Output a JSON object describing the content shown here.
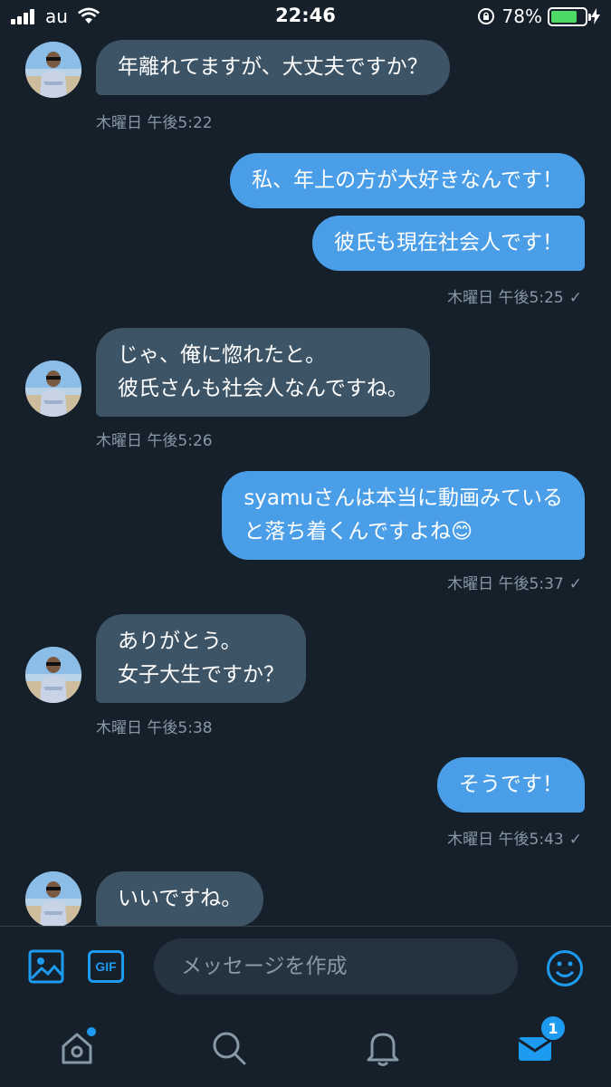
{
  "status_bar": {
    "carrier": "au",
    "time": "22:46",
    "battery_percent": "78%",
    "battery_level": 0.78,
    "signal_bars": 4
  },
  "messages": [
    {
      "direction": "in",
      "lines": [
        "年離れてますが、大丈夫ですか？"
      ],
      "timestamp": "木曜日 午後5:22"
    },
    {
      "direction": "out",
      "lines": [
        "私、年上の方が大好きなんです！"
      ],
      "timestamp": ""
    },
    {
      "direction": "out",
      "lines": [
        "彼氏も現在社会人です！"
      ],
      "timestamp": "木曜日 午後5:25"
    },
    {
      "direction": "in",
      "lines": [
        "じゃ、俺に惚れたと。",
        "彼氏さんも社会人なんですね。"
      ],
      "timestamp": "木曜日 午後5:26"
    },
    {
      "direction": "out",
      "lines": [
        "syamuさんは本当に動画みている",
        "と落ち着くんですよね😊"
      ],
      "timestamp": "木曜日 午後5:37"
    },
    {
      "direction": "in",
      "lines": [
        "ありがとう。",
        "女子大生ですか？"
      ],
      "timestamp": "木曜日 午後5:38"
    },
    {
      "direction": "out",
      "lines": [
        "そうです！"
      ],
      "timestamp": "木曜日 午後5:43"
    },
    {
      "direction": "in",
      "lines": [
        "いいですね。"
      ],
      "timestamp": ""
    }
  ],
  "read_check": "✓",
  "composer": {
    "placeholder": "メッセージを作成",
    "gif_label": "GIF",
    "image_icon": "image-icon",
    "emoji_icon": "emoji-icon"
  },
  "tabbar": {
    "items": [
      "home-icon",
      "search-icon",
      "notifications-icon",
      "messages-icon"
    ],
    "messages_badge": "1"
  },
  "colors": {
    "background": "#15202b",
    "incoming_bubble": "#3d5466",
    "outgoing_bubble": "#4a9ee8",
    "accent": "#1d9bf0",
    "timestamp": "#8899a6"
  }
}
